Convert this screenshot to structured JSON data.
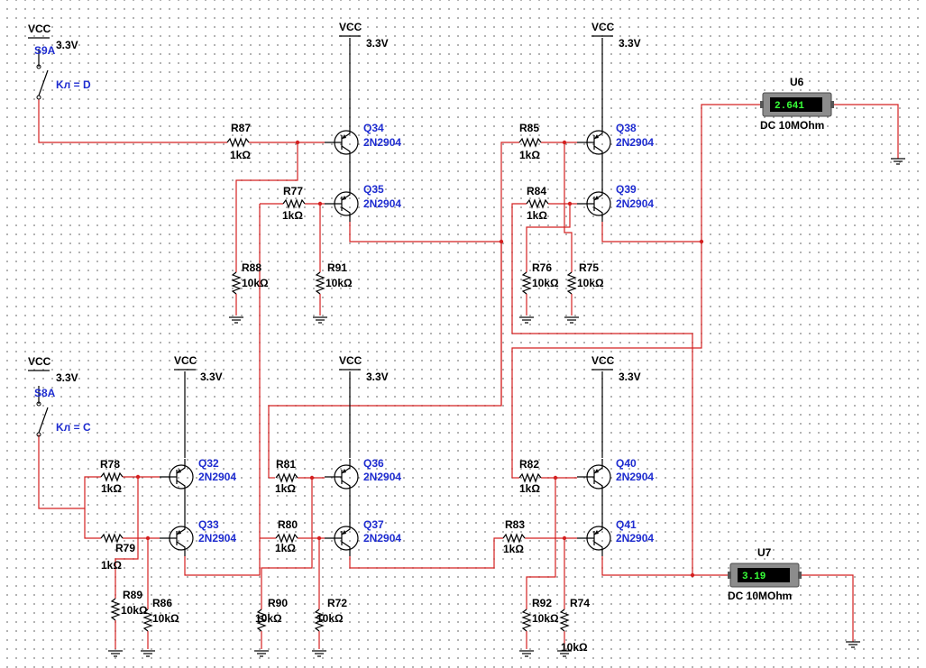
{
  "supplies": {
    "vcc_label": "VCC",
    "voltage": "3.3V"
  },
  "switches": [
    {
      "ref": "S9A",
      "key": "Kл = D"
    },
    {
      "ref": "S8A",
      "key": "Kл = C"
    }
  ],
  "transistors": {
    "part": "2N2904",
    "refs": [
      "Q34",
      "Q35",
      "Q38",
      "Q39",
      "Q32",
      "Q33",
      "Q36",
      "Q37",
      "Q40",
      "Q41"
    ]
  },
  "resistors": [
    {
      "ref": "R87",
      "value": "1kΩ"
    },
    {
      "ref": "R77",
      "value": "1kΩ"
    },
    {
      "ref": "R88",
      "value": "10kΩ"
    },
    {
      "ref": "R91",
      "value": "10kΩ"
    },
    {
      "ref": "R85",
      "value": "1kΩ"
    },
    {
      "ref": "R84",
      "value": "1kΩ"
    },
    {
      "ref": "R76",
      "value": "10kΩ"
    },
    {
      "ref": "R75",
      "value": "10kΩ"
    },
    {
      "ref": "R78",
      "value": "1kΩ"
    },
    {
      "ref": "R79",
      "value": "1kΩ"
    },
    {
      "ref": "R89",
      "value": "10kΩ"
    },
    {
      "ref": "R86",
      "value": "10kΩ"
    },
    {
      "ref": "R81",
      "value": "1kΩ"
    },
    {
      "ref": "R80",
      "value": "1kΩ"
    },
    {
      "ref": "R90",
      "value": "10kΩ"
    },
    {
      "ref": "R72",
      "value": "10kΩ"
    },
    {
      "ref": "R82",
      "value": "1kΩ"
    },
    {
      "ref": "R83",
      "value": "1kΩ"
    },
    {
      "ref": "R92",
      "value": "10kΩ"
    },
    {
      "ref": "R74",
      "value": "10kΩ"
    }
  ],
  "meters": [
    {
      "ref": "U6",
      "reading": "2.641",
      "mode": "DC  10MOhm"
    },
    {
      "ref": "U7",
      "reading": "3.19",
      "mode": "DC  10MOhm"
    }
  ],
  "colors": {
    "wire": "#d42020",
    "label": "#1e2cd0",
    "meter_display": "#38ff38"
  }
}
